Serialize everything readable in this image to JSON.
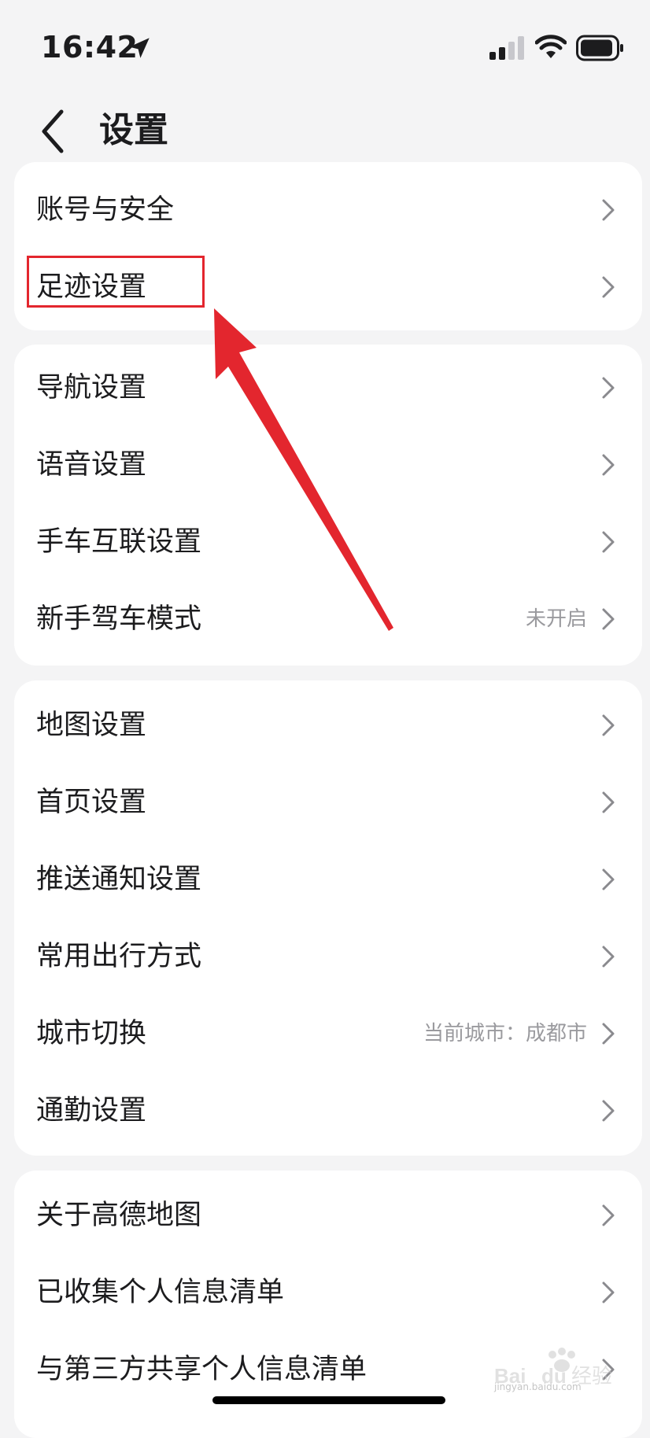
{
  "status_bar": {
    "time": "16:42"
  },
  "header": {
    "title": "设置"
  },
  "groups": [
    {
      "items": [
        {
          "label": "账号与安全",
          "value": ""
        },
        {
          "label": "足迹设置",
          "value": ""
        }
      ]
    },
    {
      "items": [
        {
          "label": "导航设置",
          "value": ""
        },
        {
          "label": "语音设置",
          "value": ""
        },
        {
          "label": "手车互联设置",
          "value": ""
        },
        {
          "label": "新手驾车模式",
          "value": "未开启"
        }
      ]
    },
    {
      "items": [
        {
          "label": "地图设置",
          "value": ""
        },
        {
          "label": "首页设置",
          "value": ""
        },
        {
          "label": "推送通知设置",
          "value": ""
        },
        {
          "label": "常用出行方式",
          "value": ""
        },
        {
          "label": "城市切换",
          "value": "当前城市：成都市"
        },
        {
          "label": "通勤设置",
          "value": ""
        }
      ]
    },
    {
      "items": [
        {
          "label": "关于高德地图",
          "value": ""
        },
        {
          "label": "已收集个人信息清单",
          "value": ""
        },
        {
          "label": "与第三方共享个人信息清单",
          "value": ""
        }
      ]
    }
  ],
  "annotation": {
    "highlight_color": "#e3262e"
  },
  "watermark": {
    "text": "jingyan.baidu.com",
    "logo_text": "Baidu经验"
  },
  "icons": {
    "location": "location-arrow-icon",
    "signal": "cellular-signal-icon",
    "wifi": "wifi-icon",
    "battery": "battery-icon",
    "back": "chevron-left-icon",
    "chevron": "chevron-right-icon"
  }
}
